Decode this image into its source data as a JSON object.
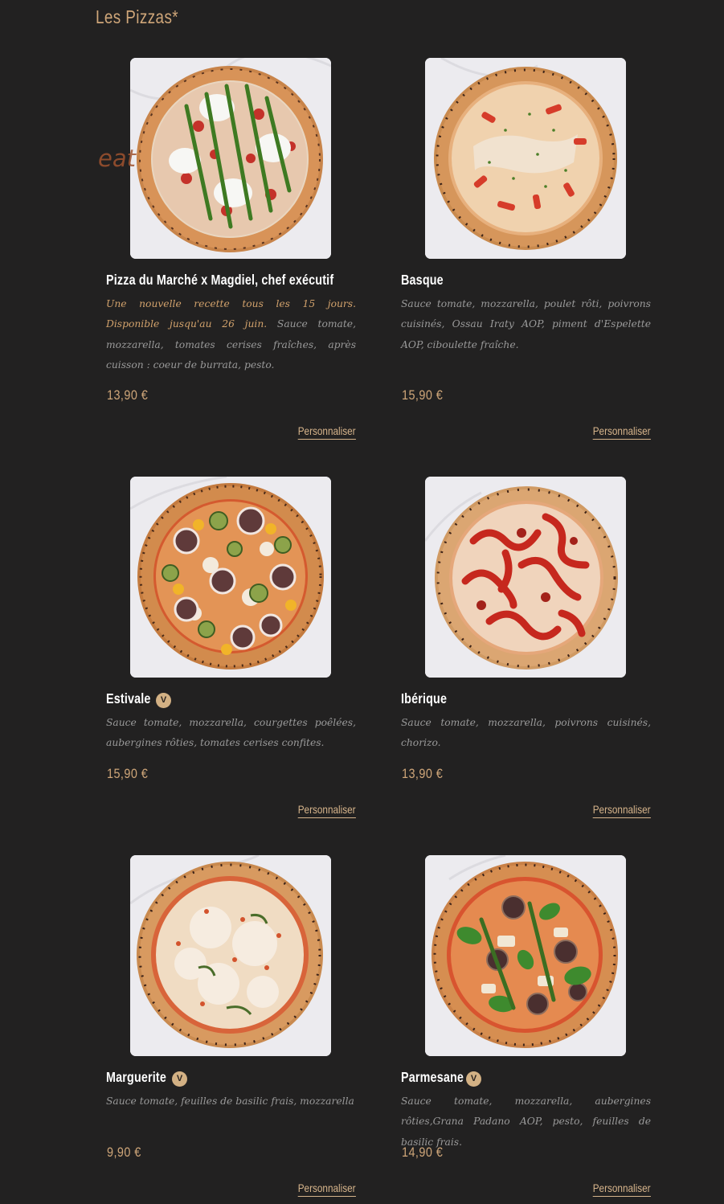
{
  "section": {
    "title": "Les Pizzas*",
    "watermark_text": "eat"
  },
  "colors": {
    "background": "#222121",
    "accent": "#cfa679",
    "note": "#d2a26c",
    "description": "#9a9a9a",
    "veg_badge": "#d3b184"
  },
  "pizzas": [
    {
      "name": "Pizza du Marché x Magdiel, chef exécutif",
      "vegetarian": false,
      "note": "Une nouvelle recette tous les 15 jours. Disponible jusqu'au 26 juin.",
      "description": "Sauce tomate, mozzarella, tomates cerises fraîches, après cuisson : coeur de burrata, pesto.",
      "price": "13,90 €",
      "customize_label": "Personnaliser",
      "image": "pizza-marche-photo"
    },
    {
      "name": "Basque",
      "vegetarian": false,
      "note": "",
      "description": "Sauce tomate, mozzarella, poulet rôti, poivrons cuisinés, Ossau Iraty AOP, piment d'Espelette AOP, ciboulette fraîche.",
      "price": "15,90 €",
      "customize_label": "Personnaliser",
      "image": "pizza-basque-photo"
    },
    {
      "name": "Estivale",
      "vegetarian": true,
      "veg_badge_label": "V",
      "note": "",
      "description": "Sauce tomate, mozzarella, courgettes poêlées, aubergines rôties, tomates cerises confites.",
      "price": "15,90 €",
      "customize_label": "Personnaliser",
      "image": "pizza-estivale-photo"
    },
    {
      "name": "Ibérique",
      "vegetarian": false,
      "note": "",
      "description": "Sauce tomate, mozzarella, poivrons cuisinés, chorizo.",
      "price": "13,90 €",
      "customize_label": "Personnaliser",
      "image": "pizza-iberique-photo"
    },
    {
      "name": "Marguerite",
      "vegetarian": true,
      "veg_badge_label": "V",
      "note": "",
      "description": "Sauce tomate, feuilles de basilic frais, mozzarella",
      "price": "9,90 €",
      "customize_label": "Personnaliser",
      "image": "pizza-marguerite-photo"
    },
    {
      "name": "Parmesane",
      "vegetarian": true,
      "veg_badge_label": "V",
      "note": "",
      "description": "Sauce tomate, mozzarella, aubergines rôties,Grana Padano AOP, pesto, feuilles de basilic frais.",
      "price": "14,90 €",
      "customize_label": "Personnaliser",
      "image": "pizza-parmesane-photo"
    }
  ]
}
